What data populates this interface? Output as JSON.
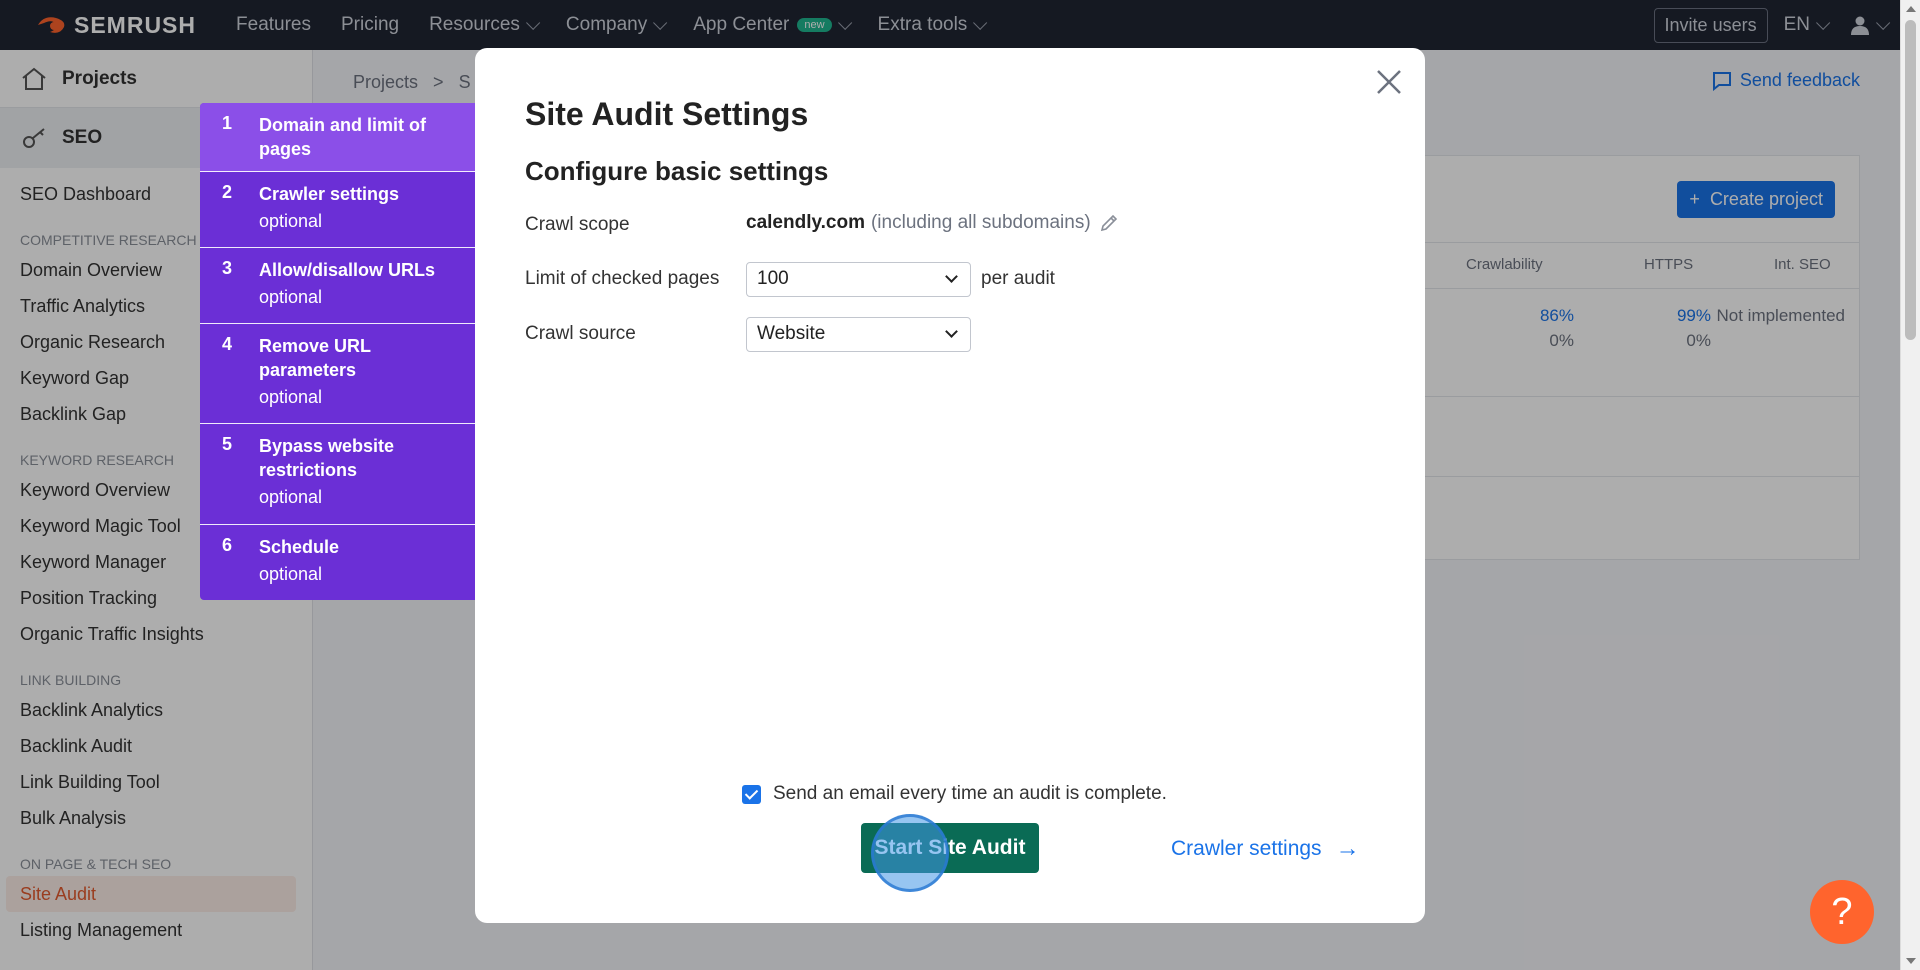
{
  "topnav": {
    "logo": "SEMRUSH",
    "items": [
      {
        "label": "Features",
        "dropdown": false
      },
      {
        "label": "Pricing",
        "dropdown": false
      },
      {
        "label": "Resources",
        "dropdown": true
      },
      {
        "label": "Company",
        "dropdown": true
      },
      {
        "label": "App Center",
        "dropdown": true,
        "badge": "new"
      },
      {
        "label": "Extra tools",
        "dropdown": true
      }
    ],
    "invite": "Invite users",
    "lang": "EN"
  },
  "sidebar": {
    "projects": "Projects",
    "seo": "SEO",
    "dashboard": "SEO Dashboard",
    "groups": [
      {
        "heading": "COMPETITIVE RESEARCH",
        "items": [
          "Domain Overview",
          "Traffic Analytics",
          "Organic Research",
          "Keyword Gap",
          "Backlink Gap"
        ]
      },
      {
        "heading": "KEYWORD RESEARCH",
        "items": [
          "Keyword Overview",
          "Keyword Magic Tool",
          "Keyword Manager",
          "Position Tracking",
          "Organic Traffic Insights"
        ]
      },
      {
        "heading": "LINK BUILDING",
        "items": [
          "Backlink Analytics",
          "Backlink Audit",
          "Link Building Tool",
          "Bulk Analysis"
        ]
      },
      {
        "heading": "ON PAGE & TECH SEO",
        "items": [
          "Site Audit",
          "Listing Management"
        ]
      }
    ]
  },
  "content": {
    "breadcrumb_root": "Projects",
    "breadcrumb_sep": ">",
    "breadcrumb_current": "S",
    "feedback": "Send feedback",
    "create_project": "Create project",
    "columns": [
      "Crawlability",
      "HTTPS",
      "Int. SEO"
    ],
    "row": {
      "crawlability": "86%",
      "crawlability_change": "0%",
      "https": "99%",
      "https_change": "0%",
      "int_seo": "Not implemented"
    }
  },
  "steps": [
    {
      "num": "1",
      "title": "Domain and limit of pages",
      "sub": ""
    },
    {
      "num": "2",
      "title": "Crawler settings",
      "sub": "optional"
    },
    {
      "num": "3",
      "title": "Allow/disallow URLs",
      "sub": "optional"
    },
    {
      "num": "4",
      "title": "Remove URL parameters",
      "sub": "optional"
    },
    {
      "num": "5",
      "title": "Bypass website restrictions",
      "sub": "optional"
    },
    {
      "num": "6",
      "title": "Schedule",
      "sub": "optional"
    }
  ],
  "modal": {
    "title": "Site Audit Settings",
    "subtitle": "Configure basic settings",
    "crawl_scope_label": "Crawl scope",
    "crawl_scope_domain": "calendly.com",
    "crawl_scope_note": "(including all subdomains)",
    "limit_label": "Limit of checked pages",
    "limit_value": "100",
    "per_audit": "per audit",
    "source_label": "Crawl source",
    "source_value": "Website",
    "email_checked": true,
    "email_text": "Send an email every time an audit is complete.",
    "start_button": "Start Site Audit",
    "next_link": "Crawler settings"
  },
  "help": "?",
  "colors": {
    "nav_bg": "#1f2533",
    "steps_bg": "#6b2fd6",
    "step_active": "#8b4fe8",
    "start_btn": "#0a6b55",
    "link": "#1a73e8",
    "help_bg": "#ff642d"
  }
}
